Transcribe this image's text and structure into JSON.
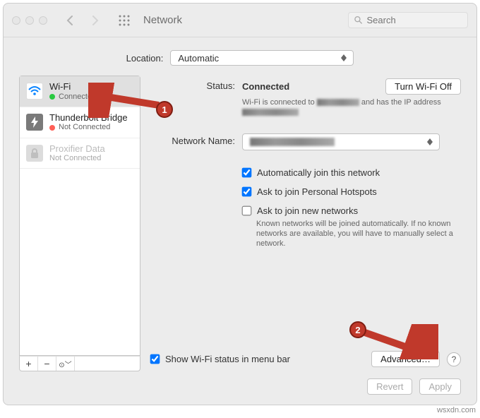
{
  "window": {
    "title": "Network"
  },
  "toolbar": {
    "search_placeholder": "Search"
  },
  "location": {
    "label": "Location:",
    "value": "Automatic"
  },
  "sidebar": {
    "items": [
      {
        "name": "Wi-Fi",
        "status": "Connected",
        "status_color": "green",
        "icon": "wifi-icon",
        "selected": true
      },
      {
        "name": "Thunderbolt Bridge",
        "status": "Not Connected",
        "status_color": "red",
        "icon": "thunderbolt-icon",
        "selected": false
      },
      {
        "name": "Proxifier Data",
        "status": "Not Connected",
        "status_color": "none",
        "icon": "lock-icon",
        "selected": false,
        "disabled": true
      }
    ]
  },
  "detail": {
    "status_label": "Status:",
    "status_value": "Connected",
    "turn_off_label": "Turn Wi-Fi Off",
    "status_desc_prefix": "Wi-Fi is connected to",
    "status_desc_mid": "and has the IP address",
    "network_name_label": "Network Name:",
    "network_name_value": "",
    "auto_join_label": "Automatically join this network",
    "personal_hotspots_label": "Ask to join Personal Hotspots",
    "ask_new_label": "Ask to join new networks",
    "ask_new_sub": "Known networks will be joined automatically. If no known networks are available, you will have to manually select a network.",
    "show_menu_label": "Show Wi-Fi status in menu bar",
    "advanced_label": "Advanced…"
  },
  "footer": {
    "revert_label": "Revert",
    "apply_label": "Apply"
  },
  "annotations": {
    "badge1": "1",
    "badge2": "2"
  },
  "watermark": "wsxdn.com"
}
